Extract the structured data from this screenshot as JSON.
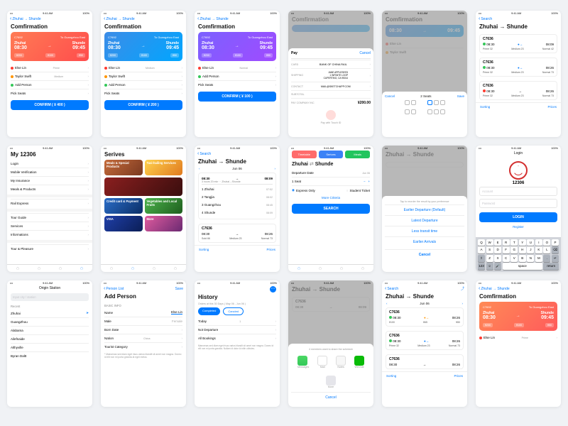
{
  "status": {
    "time": "9:41 AM",
    "carrier": "•••",
    "batt": "100%"
  },
  "nav": {
    "back_route": "Zhuhai → Shunde",
    "search": "Search",
    "person_list": "Person List",
    "save": "Save",
    "cancel": "Cancel"
  },
  "titles": {
    "confirmation": "Comfirmation",
    "my": "My 12306",
    "services": "Serives",
    "route": "Zhuhai → Shunde",
    "addperson": "Add Person",
    "history": "History",
    "origin": "Origin Station",
    "login": "Login"
  },
  "card": {
    "train": "C7692",
    "dest_tag": "To Guangzhou East",
    "from": "Zhuhai",
    "to": "Shunde",
    "depart": "08:30",
    "arrive": "09:45",
    "prices": [
      "¥200",
      "¥100",
      "¥50"
    ]
  },
  "passengers": [
    {
      "name": "Else Lin",
      "note": "Prime",
      "dot": "r"
    },
    {
      "name": "Taylor Swift",
      "note": "Medium",
      "dot": "o"
    }
  ],
  "pass_normal": "Normal",
  "add_person": "Add Person",
  "pick_seats": "Pick Seats",
  "confirm_btn": {
    "a": "CONFIRM ( ¥ 400 )",
    "b": "CONFIRM ( ¥ 200 )",
    "c": "CONFIRM ( ¥ 100 )"
  },
  "applepay": {
    "title": "Pay",
    "cancel": "Cancel",
    "card_label": "CARD",
    "card": "BANK OF CHINA RAIL",
    "ship_label": "SHIPPING",
    "ship": "JANE APPLESEED\n1 INFINITE LOOP\nCUPERTINO, CA 95014",
    "contact_label": "CONTACT",
    "contact": "MAIL@SKETCHAPP.COM",
    "sub_label": "SUBTOTAL",
    "total_label": "PAY COMPANY INC",
    "total": "¥200.00",
    "touch": "Pay with Touch ID"
  },
  "seats": {
    "title": "2 Seats",
    "save": "Save",
    "cancel": "Cancel",
    "win": "Window"
  },
  "trips": [
    {
      "id": "C7636",
      "d": "08:30",
      "a": "08:09",
      "meta1": "Prime 32",
      "meta2": "Medium 23",
      "meta3": "Normal 42"
    },
    {
      "id": "C7636",
      "d": "08:30",
      "a": "08:26",
      "meta1": "Prime 32",
      "meta2": "Medium 23",
      "meta3": "Normal 73"
    },
    {
      "id": "C7636",
      "d": "08:30",
      "a": "08:26",
      "meta1": "Prime 32",
      "meta2": "Medium 23",
      "meta3": "Normal 73"
    }
  ],
  "my": [
    "Login",
    "Mobile Verification",
    "My Insurance",
    "Meals & Products",
    "Rail Express",
    "Tour Guide",
    "Services",
    "Informations",
    "Tour & Pleasure"
  ],
  "svc": [
    "Meals & Special Products",
    "Taxi-hailing Services",
    "Vegetables and Local Fruits",
    "Credit card & Payment",
    "More"
  ],
  "search": {
    "route_from": "Zhuhai",
    "route_to": "Shunde",
    "dep_label": "Departure Date",
    "dep_val": "Jun 06",
    "seat": "1 Seat",
    "opt1": "Express Only",
    "opt2": "Student Ticket",
    "more": "More Criteria",
    "btn": "SEARCH"
  },
  "pills": [
    "Timetable",
    "Serives",
    "Meals"
  ],
  "sort_sheet": {
    "hint": "Tap to reorder the result by your preference",
    "opts": [
      "Earlier Departure (Default)",
      "Latest Departure",
      "Less transit time",
      "Earlier Arrivals",
      "Cancel"
    ]
  },
  "login": {
    "brand": "12306",
    "a": "Account",
    "p": "Password",
    "btn": "LOGIN",
    "reg": "Register"
  },
  "origin": {
    "ph": "Input city / station",
    "recent": "Recent",
    "items": [
      "Zhuhai",
      "GuangZhou",
      "Alabama",
      "Ailefnaide",
      "Althyville",
      "Byran Daltt"
    ]
  },
  "addp": {
    "sec": "BASIC INFO",
    "name": "Name",
    "name_v": "Else Lin",
    "sex": [
      "Male",
      "Female"
    ],
    "bd": "Born Date",
    "nation": "Nation",
    "nation_v": "China",
    "cat": "Tourist Category"
  },
  "addp_note": "* Maecenas sed diam eget risus varius blandit sit amet non magna. Donec id elit non mi porta gravida at eget metus.",
  "history": {
    "sub": "Orders at this 30 Days ( May 06 - Jun 06 )",
    "tabs": [
      "Completed",
      "Cancled"
    ],
    "items": [
      "Today",
      "Not Departure",
      "All Bookings"
    ]
  },
  "share": {
    "hint": "4 members want to share the schedule",
    "more": "More",
    "cancel": "Cancel",
    "apps": [
      "Messages",
      "Mail",
      "Notes",
      "WeChat"
    ]
  },
  "foot": {
    "sort": "Sorting",
    "price": "Prices"
  },
  "date_nav": {
    "prev": "‹",
    "day": "Jun 06",
    "next": "›"
  },
  "colors": {
    "accent": "#007aff",
    "danger": "#ff3b30"
  }
}
